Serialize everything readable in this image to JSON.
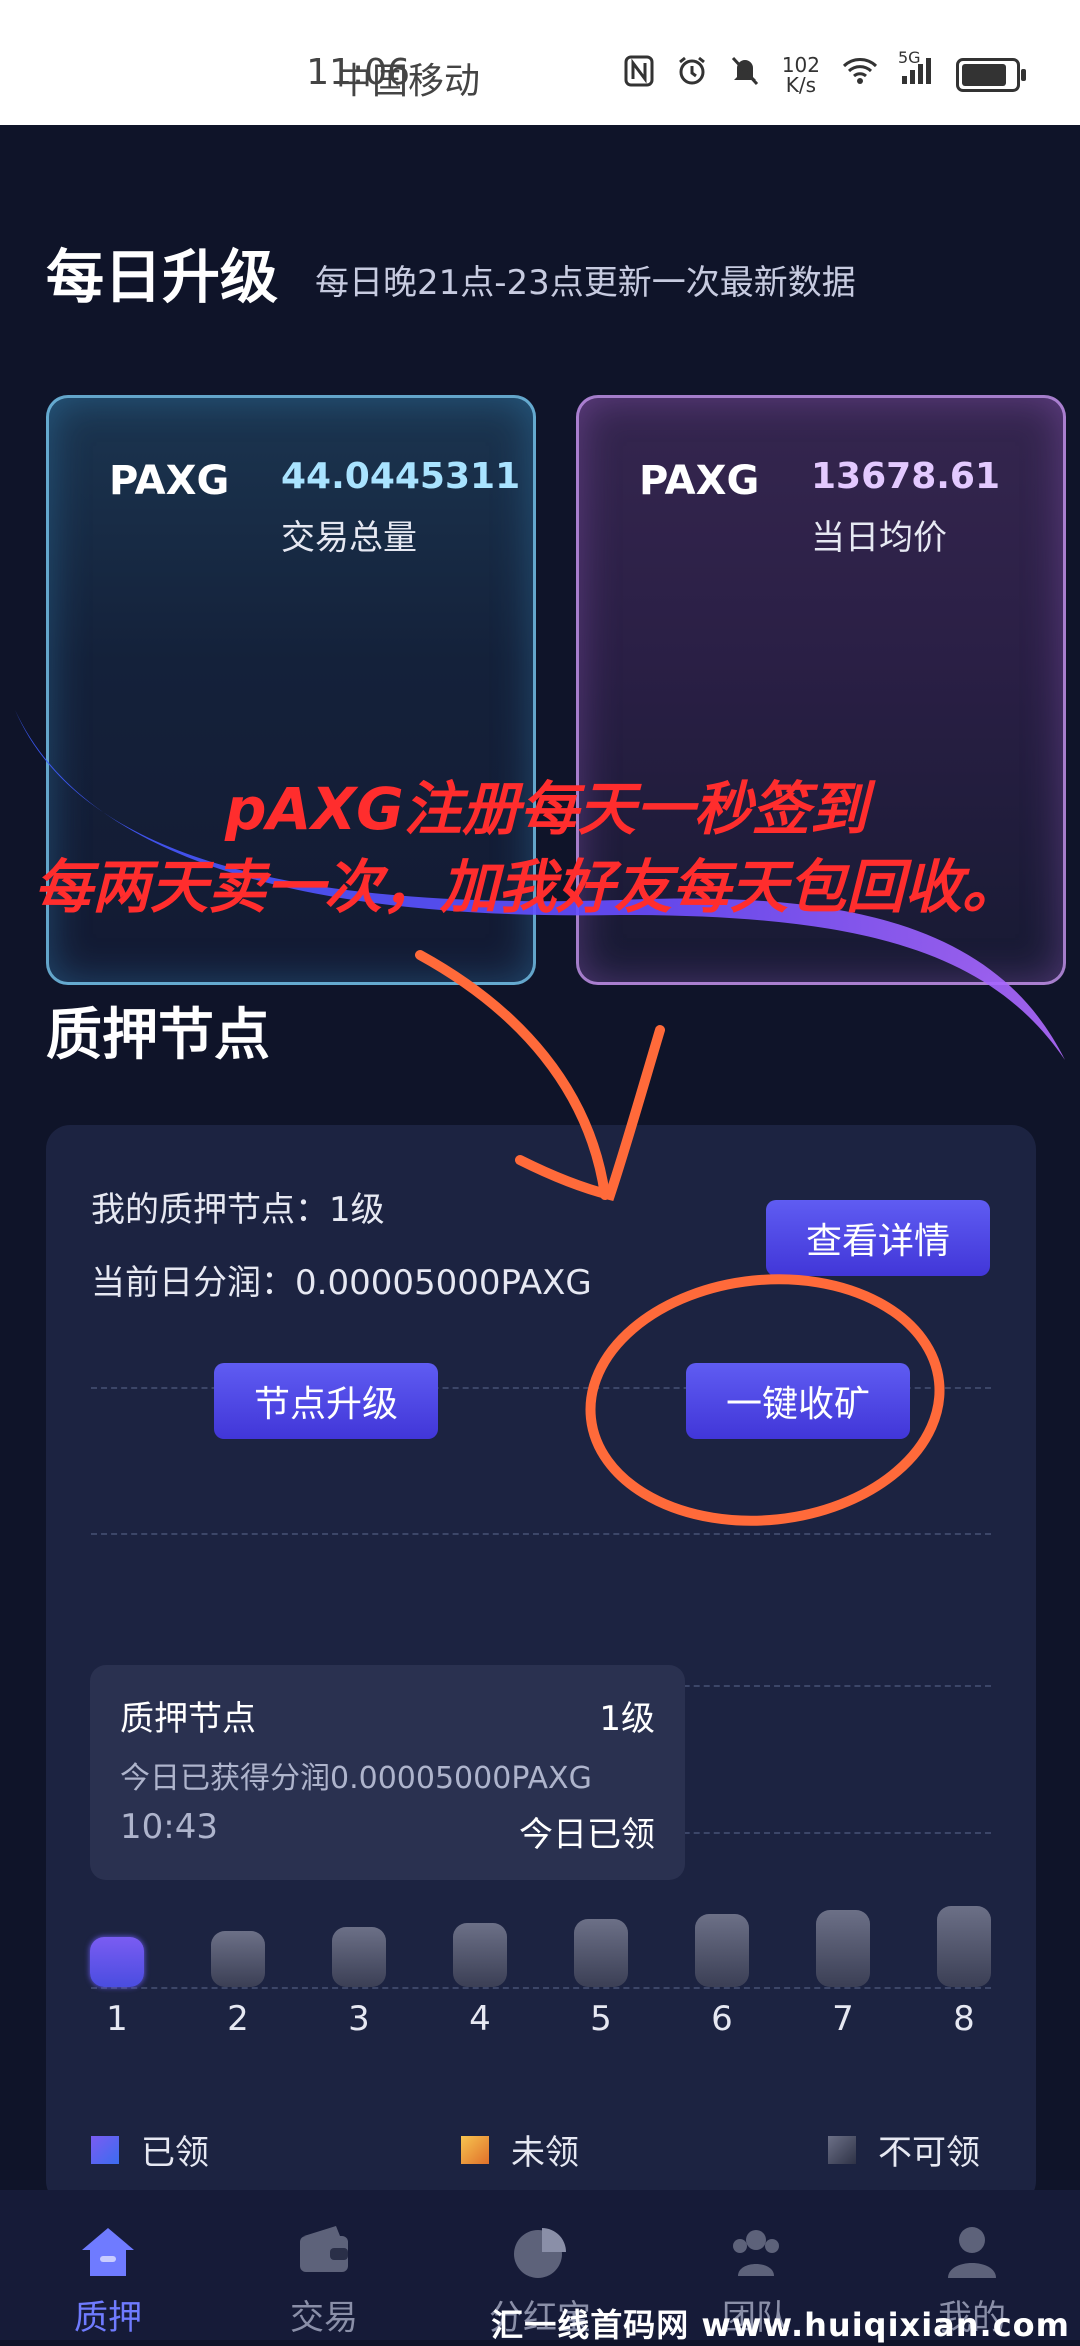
{
  "status_bar": {
    "carrier": "中国移动",
    "time": "11:06",
    "net_speed_value": "102",
    "net_speed_unit": "K/s",
    "signal": "5G",
    "icons": [
      "nfc-icon",
      "alarm-icon",
      "mute-icon",
      "wifi-icon",
      "signal-icon",
      "battery-icon"
    ]
  },
  "header": {
    "title": "每日升级",
    "subtitle": "每日晚21点-23点更新一次最新数据"
  },
  "cards": [
    {
      "token": "PAXG",
      "value": "44.0445311",
      "label": "交易总量"
    },
    {
      "token": "PAXG",
      "value": "13678.61",
      "label": "当日均价"
    }
  ],
  "promo": {
    "line1": "pAXG注册每天一秒签到",
    "line2": "每两天卖一次，加我好友每天包回收。"
  },
  "stake": {
    "section_title": "质押节点",
    "my_level_label": "我的质押节点：",
    "my_level_value": "1级",
    "daily_label": "当前日分润：",
    "daily_value": "0.00005000PAXG",
    "detail_button": "查看详情",
    "upgrade_button": "节点升级",
    "collect_button": "一键收矿",
    "tooltip": {
      "title": "质押节点",
      "level": "1级",
      "earned": "今日已获得分润0.00005000PAXG",
      "time": "10:43",
      "status": "今日已领"
    },
    "bars": [
      {
        "label": "1",
        "state": "claimed",
        "level": 0.55
      },
      {
        "label": "2",
        "state": "unavailable",
        "level": 0.62
      },
      {
        "label": "3",
        "state": "unavailable",
        "level": 0.67
      },
      {
        "label": "4",
        "state": "unavailable",
        "level": 0.71
      },
      {
        "label": "5",
        "state": "unavailable",
        "level": 0.76
      },
      {
        "label": "6",
        "state": "unavailable",
        "level": 0.81
      },
      {
        "label": "7",
        "state": "unavailable",
        "level": 0.85
      },
      {
        "label": "8",
        "state": "unavailable",
        "level": 0.9
      }
    ],
    "legend": [
      {
        "label": "已领",
        "color": "#5a52e8"
      },
      {
        "label": "未领",
        "color": "#f0a23a"
      },
      {
        "label": "不可领",
        "color": "#5a5e74"
      }
    ]
  },
  "nav": {
    "items": [
      {
        "label": "质押",
        "icon": "home-icon",
        "active": true
      },
      {
        "label": "交易",
        "icon": "wallet-icon",
        "active": false
      },
      {
        "label": "分红宝",
        "icon": "pie-chart-icon",
        "active": false
      },
      {
        "label": "团队",
        "icon": "team-icon",
        "active": false
      },
      {
        "label": "我的",
        "icon": "user-icon",
        "active": false
      }
    ]
  },
  "watermark": "汇一线首码网 www.huiqixian.com",
  "colors": {
    "background": "#0f1429",
    "accent": "#5a52e8",
    "promo_text": "#ff2d2d",
    "annotation": "#ff6a3a"
  }
}
